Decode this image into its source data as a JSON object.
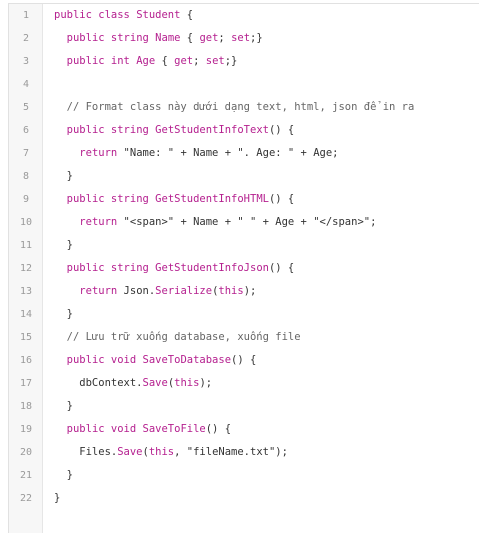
{
  "editor": {
    "lines": [
      {
        "num": "1",
        "tokens": [
          {
            "t": "public class ",
            "c": "k"
          },
          {
            "t": "Student",
            "c": "t"
          },
          {
            "t": " {",
            "c": "n"
          }
        ]
      },
      {
        "num": "2",
        "tokens": [
          {
            "t": "  ",
            "c": "n"
          },
          {
            "t": "public string ",
            "c": "k"
          },
          {
            "t": "Name",
            "c": "t"
          },
          {
            "t": " { ",
            "c": "n"
          },
          {
            "t": "get",
            "c": "k"
          },
          {
            "t": "; ",
            "c": "n"
          },
          {
            "t": "set",
            "c": "k"
          },
          {
            "t": ";}",
            "c": "n"
          }
        ]
      },
      {
        "num": "3",
        "tokens": [
          {
            "t": "  ",
            "c": "n"
          },
          {
            "t": "public int ",
            "c": "k"
          },
          {
            "t": "Age",
            "c": "t"
          },
          {
            "t": " { ",
            "c": "n"
          },
          {
            "t": "get",
            "c": "k"
          },
          {
            "t": "; ",
            "c": "n"
          },
          {
            "t": "set",
            "c": "k"
          },
          {
            "t": ";}",
            "c": "n"
          }
        ]
      },
      {
        "num": "4",
        "tokens": []
      },
      {
        "num": "5",
        "tokens": [
          {
            "t": "  // Format class này dưới dạng text, html, json để in ra",
            "c": "c"
          }
        ]
      },
      {
        "num": "6",
        "tokens": [
          {
            "t": "  ",
            "c": "n"
          },
          {
            "t": "public string ",
            "c": "k"
          },
          {
            "t": "GetStudentInfoText",
            "c": "f"
          },
          {
            "t": "() {",
            "c": "n"
          }
        ]
      },
      {
        "num": "7",
        "tokens": [
          {
            "t": "    ",
            "c": "n"
          },
          {
            "t": "return",
            "c": "k"
          },
          {
            "t": " \"Name: \" + Name + \". Age: \" + Age;",
            "c": "s"
          }
        ]
      },
      {
        "num": "8",
        "tokens": [
          {
            "t": "  }",
            "c": "n"
          }
        ]
      },
      {
        "num": "9",
        "tokens": [
          {
            "t": "  ",
            "c": "n"
          },
          {
            "t": "public string ",
            "c": "k"
          },
          {
            "t": "GetStudentInfoHTML",
            "c": "f"
          },
          {
            "t": "() {",
            "c": "n"
          }
        ]
      },
      {
        "num": "10",
        "tokens": [
          {
            "t": "    ",
            "c": "n"
          },
          {
            "t": "return",
            "c": "k"
          },
          {
            "t": " \"<span>\" + Name + \" \" + Age + \"</span>\";",
            "c": "s"
          }
        ]
      },
      {
        "num": "11",
        "tokens": [
          {
            "t": "  }",
            "c": "n"
          }
        ]
      },
      {
        "num": "12",
        "tokens": [
          {
            "t": "  ",
            "c": "n"
          },
          {
            "t": "public string ",
            "c": "k"
          },
          {
            "t": "GetStudentInfoJson",
            "c": "f"
          },
          {
            "t": "() {",
            "c": "n"
          }
        ]
      },
      {
        "num": "13",
        "tokens": [
          {
            "t": "    ",
            "c": "n"
          },
          {
            "t": "return",
            "c": "k"
          },
          {
            "t": " Json.",
            "c": "n"
          },
          {
            "t": "Serialize",
            "c": "f"
          },
          {
            "t": "(",
            "c": "n"
          },
          {
            "t": "this",
            "c": "k"
          },
          {
            "t": ");",
            "c": "n"
          }
        ]
      },
      {
        "num": "14",
        "tokens": [
          {
            "t": "  }",
            "c": "n"
          }
        ]
      },
      {
        "num": "15",
        "tokens": [
          {
            "t": "  // Lưu trữ xuống database, xuống file",
            "c": "c"
          }
        ]
      },
      {
        "num": "16",
        "tokens": [
          {
            "t": "  ",
            "c": "n"
          },
          {
            "t": "public void ",
            "c": "k"
          },
          {
            "t": "SaveToDatabase",
            "c": "f"
          },
          {
            "t": "() {",
            "c": "n"
          }
        ]
      },
      {
        "num": "17",
        "tokens": [
          {
            "t": "    dbContext.",
            "c": "n"
          },
          {
            "t": "Save",
            "c": "f"
          },
          {
            "t": "(",
            "c": "n"
          },
          {
            "t": "this",
            "c": "k"
          },
          {
            "t": ");",
            "c": "n"
          }
        ]
      },
      {
        "num": "18",
        "tokens": [
          {
            "t": "  }",
            "c": "n"
          }
        ]
      },
      {
        "num": "19",
        "tokens": [
          {
            "t": "  ",
            "c": "n"
          },
          {
            "t": "public void ",
            "c": "k"
          },
          {
            "t": "SaveToFile",
            "c": "f"
          },
          {
            "t": "() {",
            "c": "n"
          }
        ]
      },
      {
        "num": "20",
        "tokens": [
          {
            "t": "    Files.",
            "c": "n"
          },
          {
            "t": "Save",
            "c": "f"
          },
          {
            "t": "(",
            "c": "n"
          },
          {
            "t": "this",
            "c": "k"
          },
          {
            "t": ", \"fileName.txt\");",
            "c": "s"
          }
        ]
      },
      {
        "num": "21",
        "tokens": [
          {
            "t": "  }",
            "c": "n"
          }
        ]
      },
      {
        "num": "22",
        "tokens": [
          {
            "t": "}",
            "c": "n"
          }
        ]
      }
    ]
  },
  "colors": {
    "keyword": "#b5208f",
    "text": "#333333",
    "comment": "#666666",
    "line_number": "#9a9a9a",
    "gutter_bg": "#f7f7f7"
  }
}
